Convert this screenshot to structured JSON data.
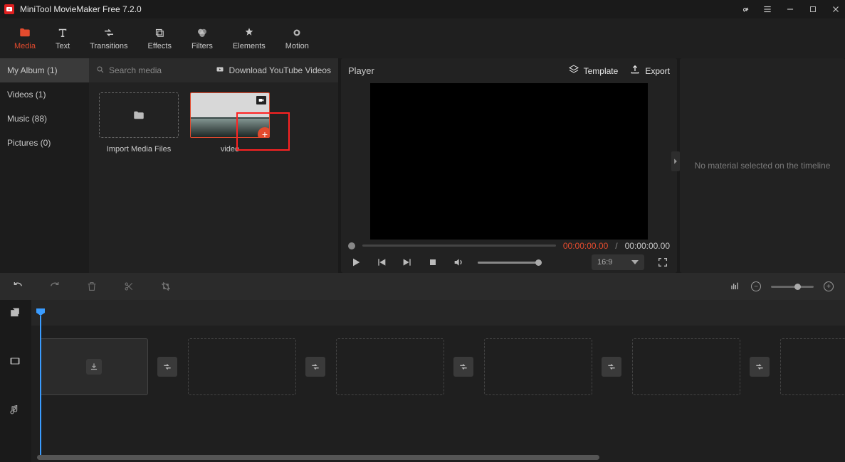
{
  "app": {
    "title": "MiniTool MovieMaker Free 7.2.0"
  },
  "tabs": {
    "media": {
      "label": "Media"
    },
    "text": {
      "label": "Text"
    },
    "transitions": {
      "label": "Transitions"
    },
    "effects": {
      "label": "Effects"
    },
    "filters": {
      "label": "Filters"
    },
    "elements": {
      "label": "Elements"
    },
    "motion": {
      "label": "Motion"
    }
  },
  "sidebar": {
    "album": {
      "label": "My Album (1)"
    },
    "videos": {
      "label": "Videos (1)"
    },
    "music": {
      "label": "Music (88)"
    },
    "pictures": {
      "label": "Pictures (0)"
    }
  },
  "media": {
    "search_placeholder": "Search media",
    "download_label": "Download YouTube Videos",
    "import_label": "Import Media Files",
    "thumb1_label": "video"
  },
  "player": {
    "title": "Player",
    "template_label": "Template",
    "export_label": "Export",
    "time_current": "00:00:00.00",
    "time_sep": "/",
    "time_total": "00:00:00.00",
    "aspect": "16:9"
  },
  "inspector": {
    "empty_text": "No material selected on the timeline"
  }
}
